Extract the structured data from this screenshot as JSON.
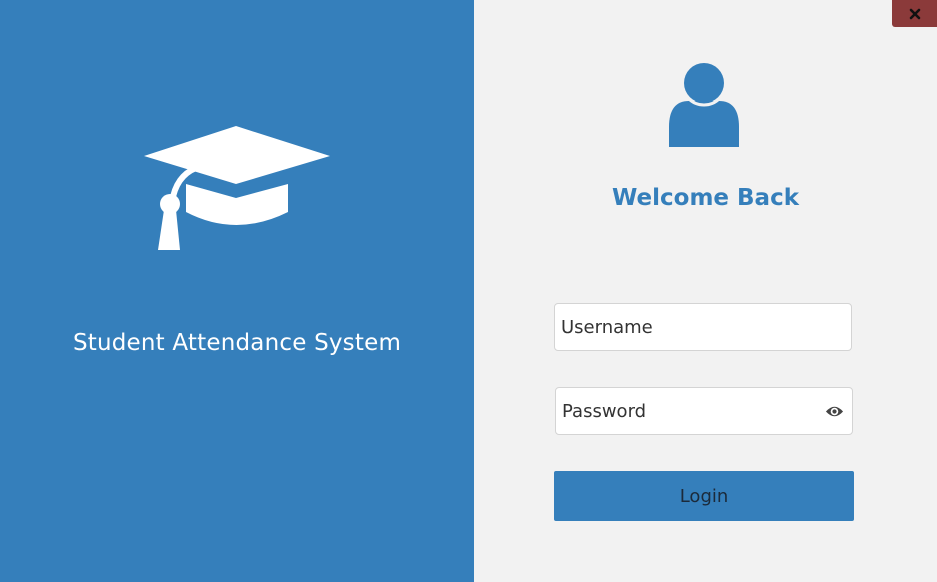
{
  "app": {
    "title": "Student Attendance System",
    "icon": "graduation-cap-icon"
  },
  "window": {
    "close_icon": "close-icon"
  },
  "login": {
    "user_icon": "user-icon",
    "heading": "Welcome Back",
    "username_placeholder": "Username",
    "username_value": "",
    "password_placeholder": "Password",
    "password_value": "",
    "reveal_icon": "eye-icon",
    "button_label": "Login"
  },
  "colors": {
    "brand": "#357fbb",
    "background": "#f2f2f2",
    "close_button": "#8b3a3a",
    "white": "#ffffff"
  }
}
